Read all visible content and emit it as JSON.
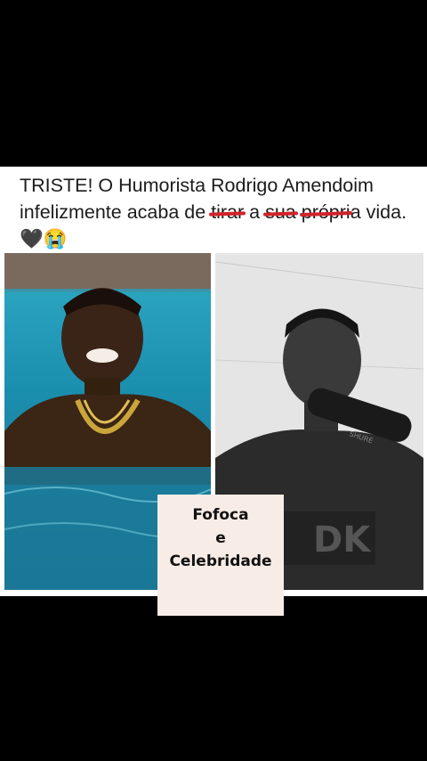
{
  "post": {
    "headline_part1": "TRISTE! O Humorista Rodrigo Amendoim infelizmente acaba de ",
    "struck_1": "tirar",
    "headline_part2": " a ",
    "struck_2": "sua",
    "headline_part3": " ",
    "struck_3": "própri",
    "headline_part4": "a vida. ",
    "emoji": "🖤😭"
  },
  "caption": {
    "line1": "Fofoca",
    "line2": "e",
    "line3": "Celebridade"
  }
}
